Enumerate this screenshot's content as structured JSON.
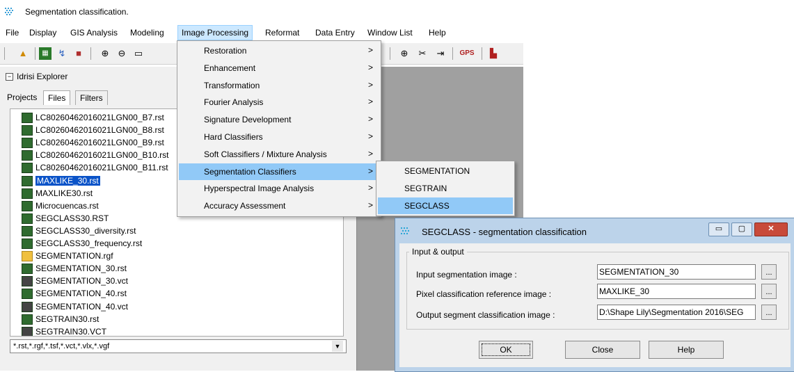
{
  "app": {
    "title": "Segmentation classification."
  },
  "menubar": {
    "items": [
      "File",
      "Display",
      "GIS Analysis",
      "Modeling",
      "Image Processing",
      "Reformat",
      "Data Entry",
      "Window List",
      "Help"
    ],
    "active": "Image Processing"
  },
  "explorer": {
    "title": "Idrisi Explorer",
    "collapse_glyph": "−",
    "tabs": [
      "Projects",
      "Files",
      "Filters"
    ],
    "selected_tab": "Files",
    "files": [
      {
        "name": "LC80260462016021LGN00_B7.rst",
        "kind": "raster"
      },
      {
        "name": "LC80260462016021LGN00_B8.rst",
        "kind": "raster"
      },
      {
        "name": "LC80260462016021LGN00_B9.rst",
        "kind": "raster"
      },
      {
        "name": "LC80260462016021LGN00_B10.rst",
        "kind": "raster"
      },
      {
        "name": "LC80260462016021LGN00_B11.rst",
        "kind": "raster"
      },
      {
        "name": "MAXLIKE_30.rst",
        "kind": "raster",
        "selected": true
      },
      {
        "name": "MAXLIKE30.rst",
        "kind": "raster"
      },
      {
        "name": "Microcuencas.rst",
        "kind": "raster"
      },
      {
        "name": "SEGCLASS30.RST",
        "kind": "raster"
      },
      {
        "name": "SEGCLASS30_diversity.rst",
        "kind": "raster"
      },
      {
        "name": "SEGCLASS30_frequency.rst",
        "kind": "raster"
      },
      {
        "name": "SEGMENTATION.rgf",
        "kind": "group"
      },
      {
        "name": "SEGMENTATION_30.rst",
        "kind": "raster"
      },
      {
        "name": "SEGMENTATION_30.vct",
        "kind": "vector"
      },
      {
        "name": "SEGMENTATION_40.rst",
        "kind": "raster"
      },
      {
        "name": "SEGMENTATION_40.vct",
        "kind": "vector"
      },
      {
        "name": "SEGTRAIN30.rst",
        "kind": "raster"
      },
      {
        "name": "SEGTRAIN30.VCT",
        "kind": "vector"
      }
    ],
    "filter": "*.rst,*.rgf,*.tsf,*.vct,*.vlx,*.vgf",
    "scroll_down_glyph": "⌄",
    "filter_drop_glyph": "▼"
  },
  "toolbar": {
    "icons": [
      "open-icon",
      "map-icon",
      "vector-icon",
      "layers-icon",
      "zoom-in-icon",
      "zoom-out-icon",
      "window-icon",
      "crosshair-icon",
      "measure-icon",
      "pan-icon",
      "gps-icon",
      "histogram-icon"
    ],
    "gps_label": "GPS"
  },
  "dropdown": {
    "items": [
      {
        "label": "Restoration",
        "arrow": ">"
      },
      {
        "label": "Enhancement",
        "arrow": ">"
      },
      {
        "label": "Transformation",
        "arrow": ">"
      },
      {
        "label": "Fourier Analysis",
        "arrow": ">"
      },
      {
        "label": "Signature Development",
        "arrow": ">"
      },
      {
        "label": "Hard Classifiers",
        "arrow": ">"
      },
      {
        "label": "Soft Classifiers / Mixture Analysis",
        "arrow": ">"
      },
      {
        "label": "Segmentation Classifiers",
        "arrow": ">",
        "highlighted": true
      },
      {
        "label": "Hyperspectral Image Analysis",
        "arrow": ">"
      },
      {
        "label": "Accuracy Assessment",
        "arrow": ">"
      }
    ]
  },
  "submenu": {
    "items": [
      {
        "label": "SEGMENTATION"
      },
      {
        "label": "SEGTRAIN"
      },
      {
        "label": "SEGCLASS",
        "highlighted": true
      }
    ]
  },
  "dialog": {
    "title": "SEGCLASS - segmentation classification",
    "minimize_glyph": "▭",
    "maximize_glyph": "▢",
    "close_glyph": "✕",
    "group_label": "Input & output",
    "fields": [
      {
        "label": "Input segmentation image :",
        "value": "SEGMENTATION_30",
        "browse": "..."
      },
      {
        "label": "Pixel classification reference image :",
        "value": "MAXLIKE_30",
        "browse": "..."
      },
      {
        "label": "Output segment classification image :",
        "value": "D:\\Shape Lily\\Segmentation 2016\\SEG",
        "browse": "..."
      }
    ],
    "buttons": {
      "ok": "OK",
      "close": "Close",
      "help": "Help"
    }
  },
  "colors": {
    "menu_highlight": "#91c9f7",
    "selection": "#0a53c8",
    "dialog_frame": "#bcd3ea",
    "workspace": "#a0a0a0"
  }
}
